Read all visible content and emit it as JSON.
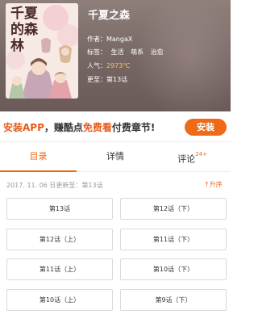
{
  "comic": {
    "title": "千夏之森",
    "cover_title": "千夏的森林",
    "author_key": "作者：",
    "author": "MangaX",
    "tags_key": "标签：",
    "tags": [
      "生活",
      "萌系",
      "治愈"
    ],
    "popularity_key": "人气：",
    "popularity": "2973℃",
    "latest_key": "更至：",
    "latest": "第13话"
  },
  "banner": {
    "part1": "安装APP",
    "part2": "，赚酷点",
    "part3": "免费看",
    "part4": "付费章节!",
    "install_label": "安装"
  },
  "tabs": [
    {
      "label": "目录",
      "active": true
    },
    {
      "label": "详情",
      "active": false
    },
    {
      "label": "评论",
      "badge": "24+",
      "active": false
    }
  ],
  "catalog": {
    "update_info": "2017. 11. 06  日更新至：第13话",
    "sort_label": "↑升序",
    "chapters": [
      "第13话",
      "第12话（下）",
      "第12话（上）",
      "第11话（下）",
      "第11话（上）",
      "第10话（下）",
      "第10话（上）",
      "第9话（下）"
    ]
  },
  "colors": {
    "accent": "#ee6a16",
    "popularity": "#f7c85a",
    "header_bg": "#766663"
  }
}
